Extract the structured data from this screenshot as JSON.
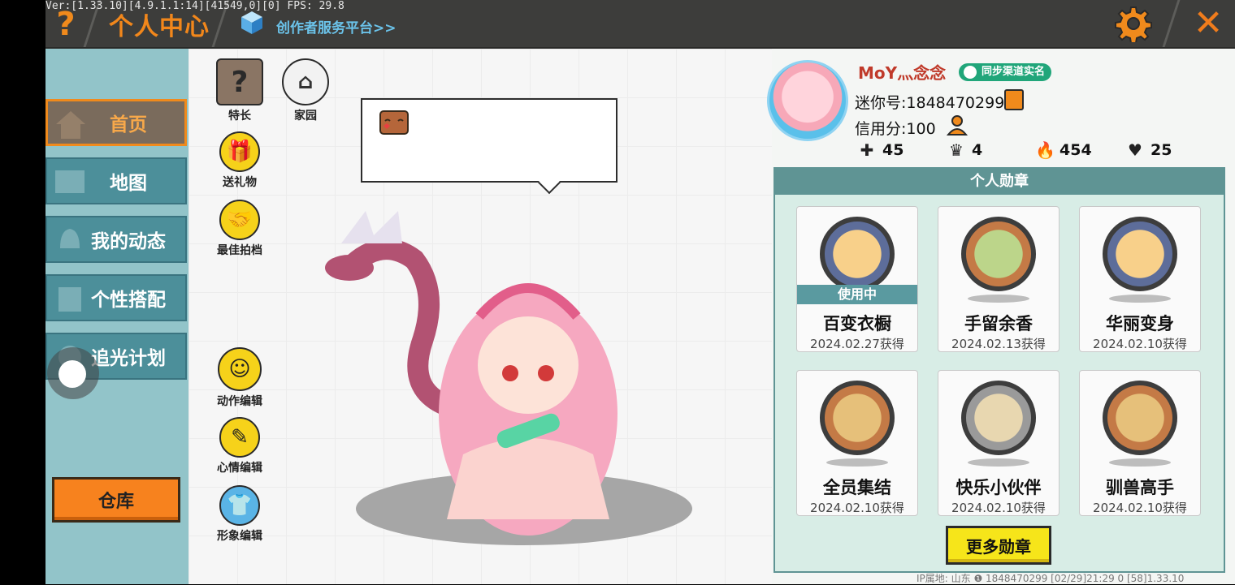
{
  "debug_text": "Ver:[1.33.10][4.9.1.1:14][41549,0][0] FPS: 29.8",
  "header": {
    "help_label": "?",
    "title": "个人中心",
    "creator_link": "创作者服务平台>>",
    "close_label": "✕"
  },
  "sidebar": {
    "items": [
      {
        "label": "首页",
        "active": true
      },
      {
        "label": "地图"
      },
      {
        "label": "我的动态"
      },
      {
        "label": "个性搭配"
      },
      {
        "label": "追光计划"
      }
    ],
    "warehouse_label": "仓库"
  },
  "tools": {
    "specialty": "特长",
    "home": "家园",
    "gift": "送礼物",
    "best_shot": "最佳拍档",
    "action_edit": "动作编辑",
    "mood_edit": "心情编辑",
    "image_edit": "形象编辑"
  },
  "profile": {
    "nickname": "MoY灬念念",
    "sync_badge": "同步渠道实名",
    "mini_id": "迷你号:1848470299",
    "credit": "信用分:100",
    "stats": {
      "friends": "45",
      "fans": "4",
      "popularity": "454",
      "likes": "25"
    }
  },
  "medals": {
    "header": "个人勋章",
    "in_use_label": "使用中",
    "items": [
      {
        "name": "百变衣橱",
        "date": "2024.02.27获得",
        "ring": "blue",
        "in_use": true
      },
      {
        "name": "手留余香",
        "date": "2024.02.13获得",
        "ring": "bronze"
      },
      {
        "name": "华丽变身",
        "date": "2024.02.10获得",
        "ring": "blue"
      },
      {
        "name": "全员集结",
        "date": "2024.02.10获得",
        "ring": "bronze2"
      },
      {
        "name": "快乐小伙伴",
        "date": "2024.02.10获得",
        "ring": "silver"
      },
      {
        "name": "驯兽高手",
        "date": "2024.02.10获得",
        "ring": "bronze2"
      }
    ],
    "more_label": "更多勋章"
  },
  "footer": "IP属地: 山东 ❶     1848470299     [02/29]21:29 0  [58]1.33.10",
  "colors": {
    "accent_orange": "#f08a1c",
    "sidebar_teal": "#4c8f9a",
    "medal_header": "#5f9494",
    "badge_green": "#21a67a"
  }
}
